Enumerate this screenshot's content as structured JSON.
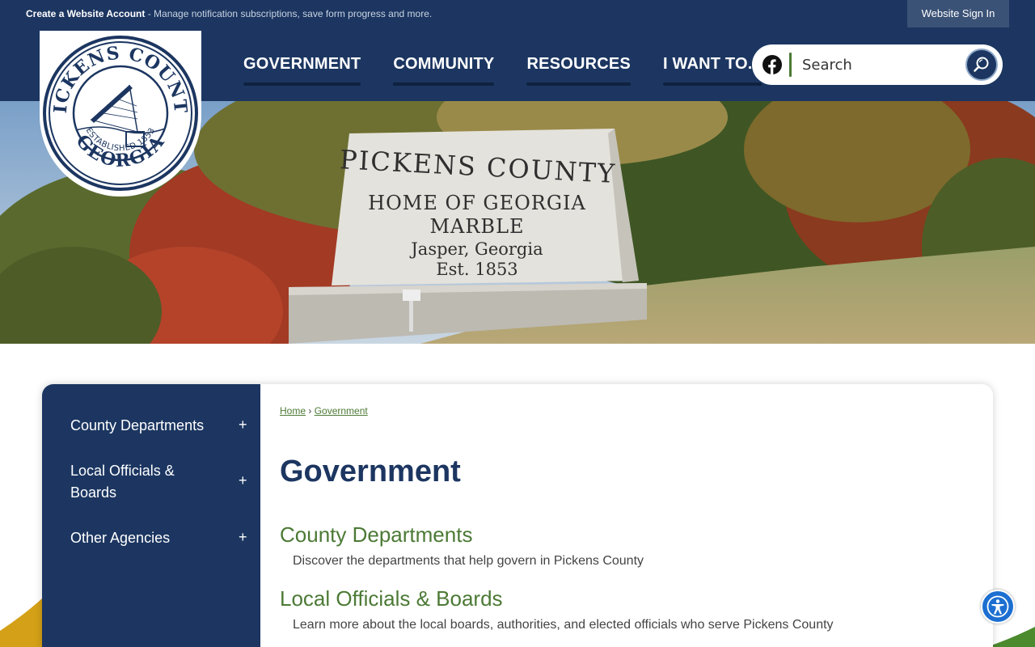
{
  "topbar": {
    "create_account": "Create a Website Account",
    "create_account_desc": " - Manage notification subscriptions, save form progress and more.",
    "signin": "Website Sign In"
  },
  "nav": [
    "GOVERNMENT",
    "COMMUNITY",
    "RESOURCES",
    "I WANT TO..."
  ],
  "search": {
    "placeholder": "Search"
  },
  "logo": {
    "top_text": "PICKENS COUNTY",
    "bottom_text": "GEORGIA",
    "est_text": "ESTABLISHED 1853"
  },
  "hero": {
    "sign_lines": [
      "PICKENS COUNTY",
      "HOME OF GEORGIA",
      "MARBLE",
      "Jasper, Georgia",
      "Est. 1853"
    ]
  },
  "sidebar": {
    "items": [
      {
        "label": "County Departments",
        "toggle": "+"
      },
      {
        "label": "Local Officials & Boards",
        "toggle": "+"
      },
      {
        "label": "Other Agencies",
        "toggle": "+"
      }
    ]
  },
  "breadcrumb": {
    "home": "Home",
    "separator": "›",
    "current": "Government"
  },
  "page_title": "Government",
  "sections": [
    {
      "title": "County Departments",
      "desc": "Discover the departments that help govern in Pickens County"
    },
    {
      "title": "Local Officials & Boards",
      "desc": "Learn more about the local boards, authorities, and elected officials who serve Pickens County"
    }
  ],
  "colors": {
    "navy": "#1c3661",
    "green": "#4c7a35",
    "accessibility_blue": "#1c6fd1"
  },
  "icons": {
    "social": "facebook-icon",
    "search": "search-icon",
    "accessibility": "accessibility-icon"
  }
}
